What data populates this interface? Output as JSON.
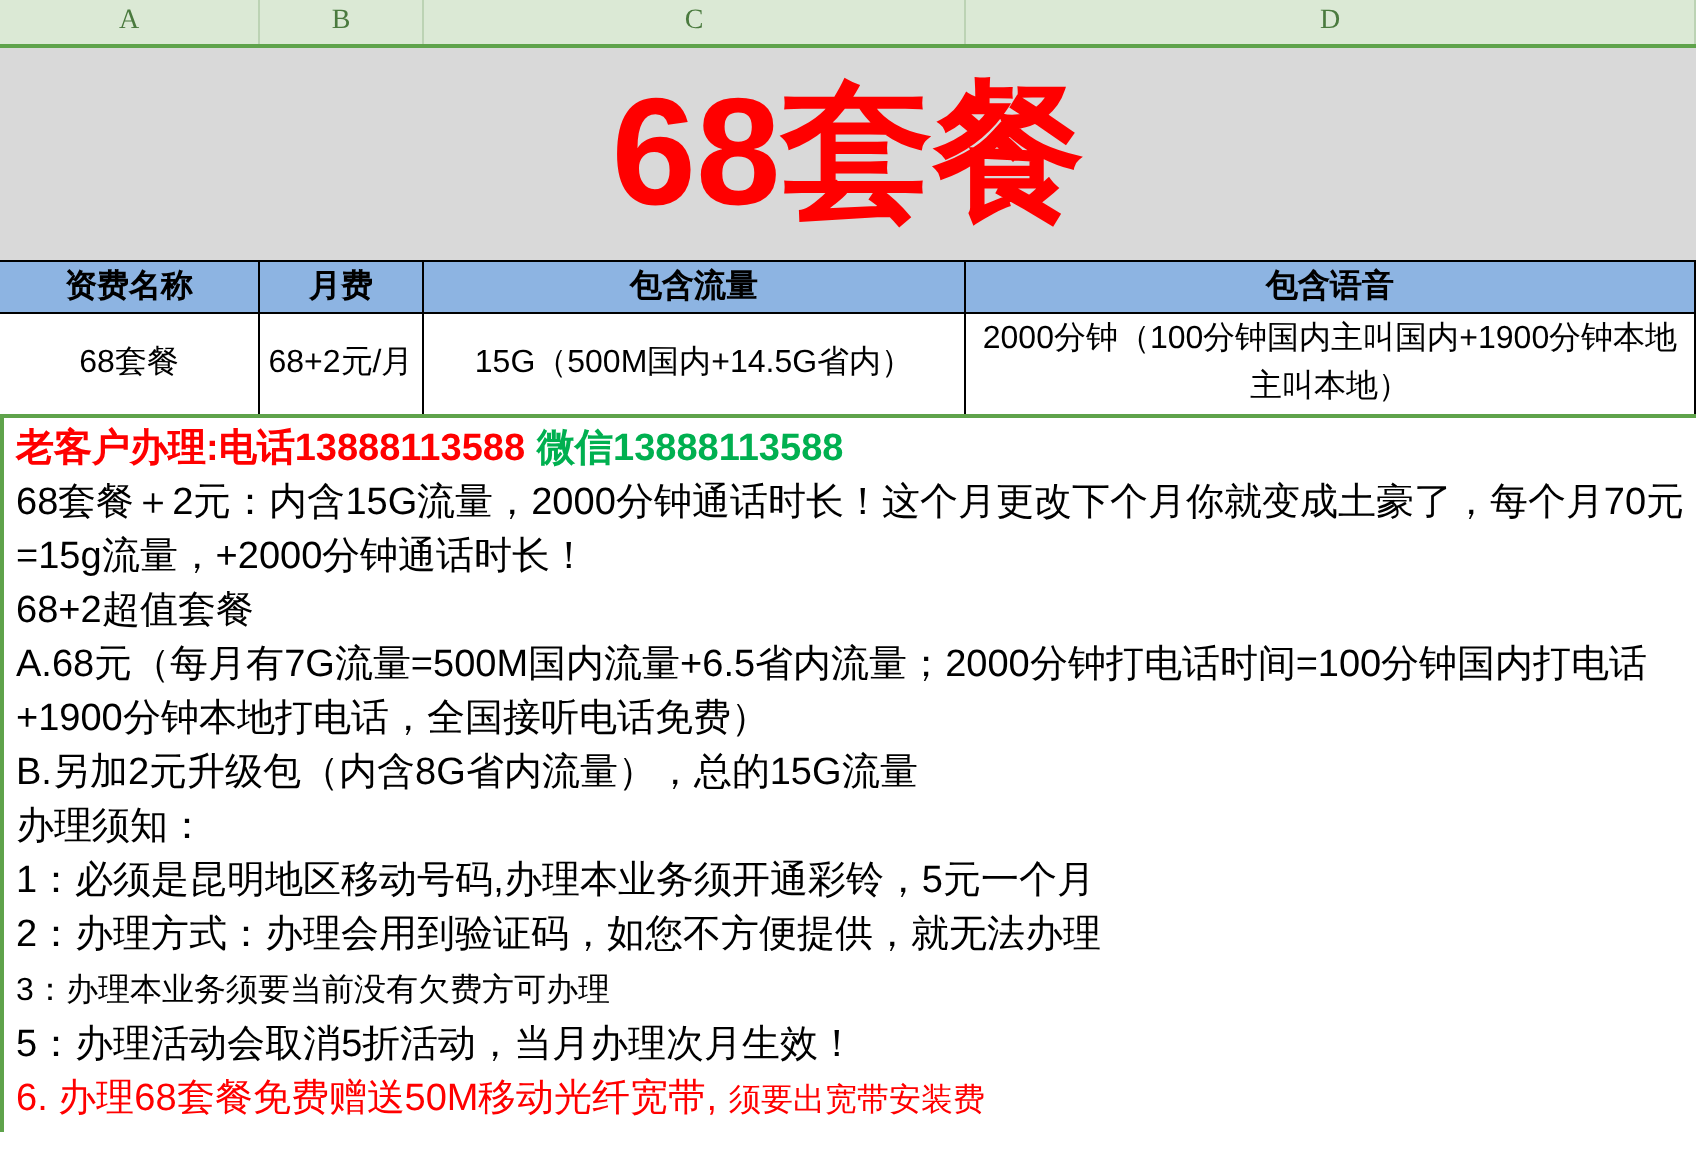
{
  "columns": [
    "A",
    "B",
    "C",
    "D"
  ],
  "title": "68套餐",
  "table": {
    "columns": [
      "资费名称",
      "月费",
      "包含流量",
      "包含语音"
    ],
    "rows": [
      [
        "68套餐",
        "68+2元/月",
        "15G（500M国内+14.5G省内）",
        "2000分钟（100分钟国内主叫国内+1900分钟本地主叫本地）"
      ]
    ]
  },
  "notes": [
    {
      "segments": [
        {
          "text": "老客户办理:电话13888113588",
          "color": "#ff0000",
          "bold": true,
          "small": false
        },
        {
          "text": "微信13888113588",
          "color": "#00b050",
          "bold": true,
          "small": false
        }
      ]
    },
    {
      "segments": [
        {
          "text": "68套餐＋2元：内含15G流量，2000分钟通话时长！这个月更改下个月你就变成土豪了，每个月70元=15g流量，+2000分钟通话时长！",
          "color": "#000000",
          "bold": false,
          "small": false
        }
      ]
    },
    {
      "segments": [
        {
          "text": "68+2超值套餐",
          "color": "#000000",
          "bold": false,
          "small": false
        }
      ]
    },
    {
      "segments": [
        {
          "text": "A.68元（每月有7G流量=500M国内流量+6.5省内流量；2000分钟打电话时间=100分钟国内打电话+1900分钟本地打电话，全国接听电话免费）",
          "color": "#000000",
          "bold": false,
          "small": false
        }
      ]
    },
    {
      "segments": [
        {
          "text": "B.另加2元升级包（内含8G省内流量），总的15G流量",
          "color": "#000000",
          "bold": false,
          "small": false
        }
      ]
    },
    {
      "segments": [
        {
          "text": "办理须知：",
          "color": "#000000",
          "bold": false,
          "small": false
        }
      ]
    },
    {
      "segments": [
        {
          "text": "1：必须是昆明地区移动号码,办理本业务须开通彩铃，5元一个月",
          "color": "#000000",
          "bold": false,
          "small": false
        }
      ]
    },
    {
      "segments": [
        {
          "text": "2：办理方式：办理会用到验证码，如您不方便提供，就无法办理",
          "color": "#000000",
          "bold": false,
          "small": false
        }
      ]
    },
    {
      "segments": [
        {
          "text": "3：办理本业务须要当前没有欠费方可办理",
          "color": "#000000",
          "bold": false,
          "small": true
        }
      ]
    },
    {
      "segments": [
        {
          "text": "5：办理活动会取消5折活动，当月办理次月生效！",
          "color": "#000000",
          "bold": false,
          "small": false
        }
      ]
    },
    {
      "segments": [
        {
          "text": "6. 办理68套餐免费赠送50M移动光纤宽带,",
          "color": "#ff0000",
          "bold": false,
          "small": false
        },
        {
          "text": "须要出宽带安装费",
          "color": "#ff0000",
          "bold": false,
          "small": true
        }
      ]
    }
  ]
}
